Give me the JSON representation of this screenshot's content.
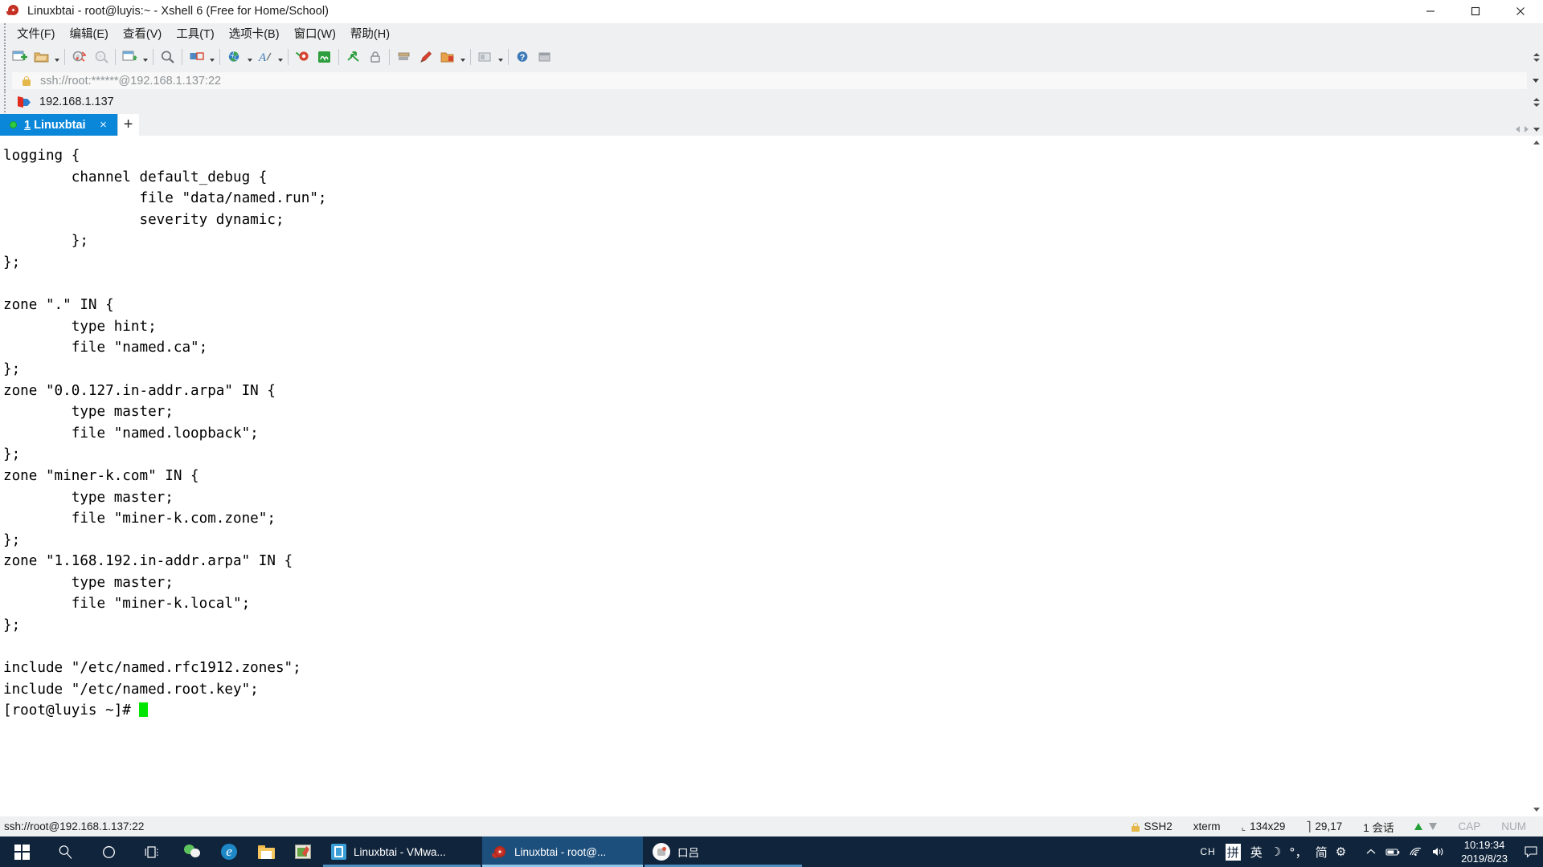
{
  "window": {
    "title": "Linuxbtai - root@luyis:~ - Xshell 6 (Free for Home/School)",
    "app_icon": "snail-icon",
    "minimize_label": "Minimize",
    "maximize_label": "Maximize",
    "close_label": "Close"
  },
  "menubar": {
    "items": [
      {
        "label": "文件(F)",
        "name": "menu-file"
      },
      {
        "label": "编辑(E)",
        "name": "menu-edit"
      },
      {
        "label": "查看(V)",
        "name": "menu-view"
      },
      {
        "label": "工具(T)",
        "name": "menu-tools"
      },
      {
        "label": "选项卡(B)",
        "name": "menu-tab"
      },
      {
        "label": "窗口(W)",
        "name": "menu-window"
      },
      {
        "label": "帮助(H)",
        "name": "menu-help"
      }
    ]
  },
  "toolbar": {
    "buttons": [
      {
        "name": "new-session-icon",
        "tip": "New Session"
      },
      {
        "name": "open-folder-icon",
        "tip": "Open"
      },
      {
        "name": "open-folder-dropdown-icon",
        "tip": "Open dropdown"
      },
      {
        "name": "disconnect-icon",
        "tip": "Disconnect"
      },
      {
        "name": "reconnect-icon",
        "tip": "Reconnect"
      },
      {
        "name": "new-file-transfer-icon",
        "tip": "File Transfer"
      },
      {
        "name": "file-transfer-dropdown-icon",
        "tip": "File Transfer dropdown"
      },
      {
        "name": "find-icon",
        "tip": "Find"
      },
      {
        "name": "layout-icon",
        "tip": "Layout"
      },
      {
        "name": "layout-dropdown-icon",
        "tip": "Layout dropdown"
      },
      {
        "name": "globe-icon",
        "tip": "Web"
      },
      {
        "name": "globe-dropdown-icon",
        "tip": "Web dropdown"
      },
      {
        "name": "font-icon",
        "tip": "Font"
      },
      {
        "name": "font-dropdown-icon",
        "tip": "Font dropdown"
      },
      {
        "name": "highlight-icon",
        "tip": "Highlight"
      },
      {
        "name": "compose-icon",
        "tip": "Compose"
      },
      {
        "name": "sftp-icon",
        "tip": "SFTP"
      },
      {
        "name": "lock-session-icon",
        "tip": "Lock"
      },
      {
        "name": "clear-screen-icon",
        "tip": "Clear Screen"
      },
      {
        "name": "pen-icon",
        "tip": "Pen"
      },
      {
        "name": "log-icon",
        "tip": "Log"
      },
      {
        "name": "log-dropdown-icon",
        "tip": "Log dropdown"
      },
      {
        "name": "properties-icon",
        "tip": "Properties"
      },
      {
        "name": "properties-dropdown-icon",
        "tip": "Properties dropdown"
      },
      {
        "name": "help-icon",
        "tip": "Help"
      },
      {
        "name": "extra-icon",
        "tip": "More"
      }
    ]
  },
  "address_bar": {
    "value": "ssh://root:******@192.168.1.137:22",
    "lock_icon": "lock-icon",
    "dropdown_icon": "chevron-down-icon"
  },
  "bookmark_bar": {
    "items": [
      {
        "label": "192.168.1.137",
        "icon": "flag-forward-icon"
      }
    ]
  },
  "tabs": {
    "items": [
      {
        "label_index": "1",
        "label": "Linuxbtai",
        "status_dot_color": "#2ecb41",
        "active": true
      }
    ],
    "new_tab_label": "+",
    "close_label": "×"
  },
  "terminal": {
    "lines": [
      "logging {",
      "        channel default_debug {",
      "                file \"data/named.run\";",
      "                severity dynamic;",
      "        };",
      "};",
      "",
      "zone \".\" IN {",
      "        type hint;",
      "        file \"named.ca\";",
      "};",
      "zone \"0.0.127.in-addr.arpa\" IN {",
      "        type master;",
      "        file \"named.loopback\";",
      "};",
      "zone \"miner-k.com\" IN {",
      "        type master;",
      "        file \"miner-k.com.zone\";",
      "};",
      "zone \"1.168.192.in-addr.arpa\" IN {",
      "        type master;",
      "        file \"miner-k.local\";",
      "};",
      "",
      "include \"/etc/named.rfc1912.zones\";",
      "include \"/etc/named.root.key\";",
      ""
    ],
    "prompt": "[root@luyis ~]# ",
    "cursor_color": "#00e500",
    "fg_color": "#000000",
    "bg_color": "#ffffff"
  },
  "status_bar": {
    "left_text": "ssh://root@192.168.1.137:22",
    "protocol": "SSH2",
    "term_type": "xterm",
    "size_icon": "terminal-size-icon",
    "size": "134x29",
    "cursor_icon": "cursor-position-icon",
    "cursor_pos": "29,17",
    "sessions": "1 会话",
    "cap": "CAP",
    "num": "NUM",
    "lock_icon": "lock-icon"
  },
  "taskbar": {
    "start_label": "Start",
    "search_icon": "search-icon",
    "cortana_icon": "cortana-circle-icon",
    "taskview_icon": "task-view-icon",
    "pinned": [
      {
        "name": "wechat-icon",
        "label": "WeChat"
      },
      {
        "name": "edge-icon",
        "label": "Microsoft Edge"
      },
      {
        "name": "file-explorer-icon",
        "label": "File Explorer"
      },
      {
        "name": "notepad-app-icon",
        "label": "Editor"
      }
    ],
    "windows": [
      {
        "label": "Linuxbtai - VMwa...",
        "icon": "vmware-icon",
        "active": false
      },
      {
        "label": "Linuxbtai - root@...",
        "icon": "xshell-snail-icon",
        "active": true
      },
      {
        "label": "口吕",
        "icon": "misc-app-icon",
        "active": false
      }
    ],
    "tray": {
      "ime_lang": "CH",
      "ime_mode": "拼",
      "ime_en": "英",
      "ime_moon": "☽",
      "ime_punct": "°，",
      "ime_simp": "简",
      "ime_gear": "⚙",
      "chevron_icon": "chevron-up-icon",
      "battery_icon": "battery-icon",
      "wifi_icon": "wifi-icon",
      "volume_icon": "volume-icon",
      "time": "10:19:34",
      "date": "2019/8/23",
      "notification_icon": "notification-icon"
    }
  }
}
